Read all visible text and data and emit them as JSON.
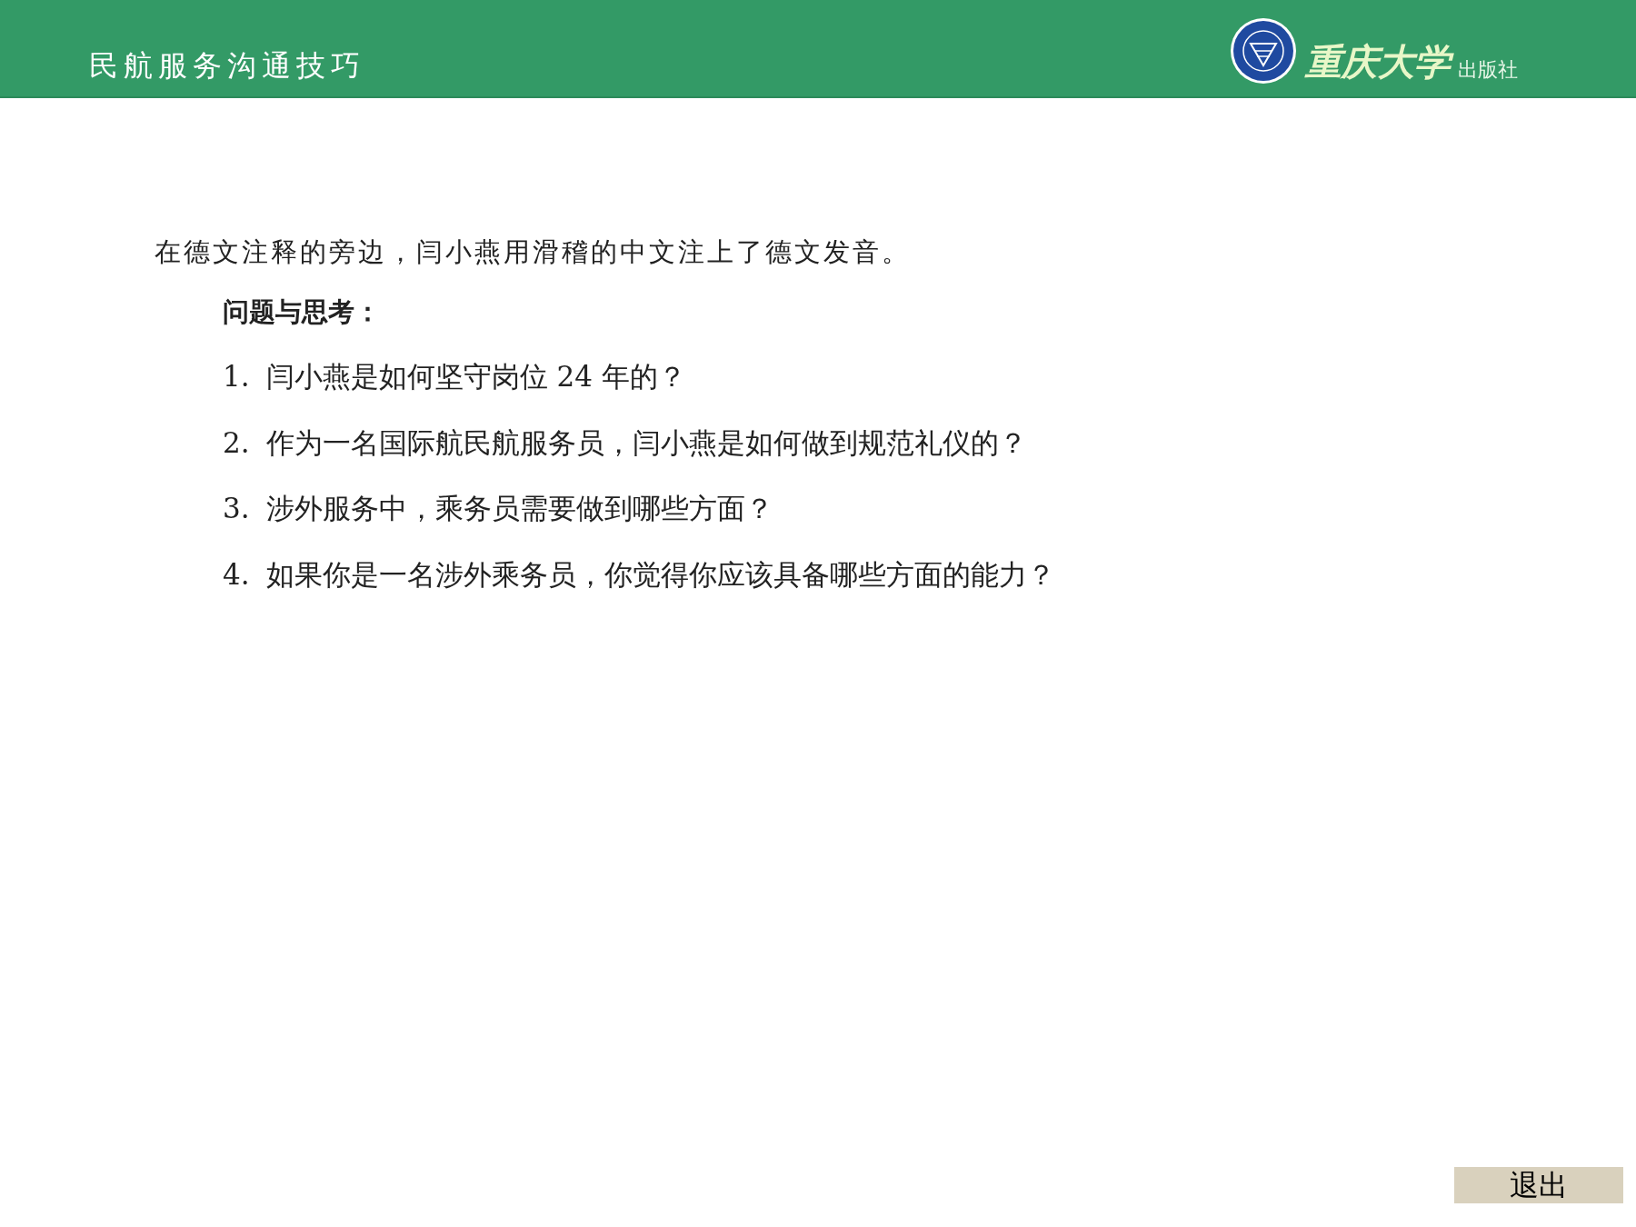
{
  "header": {
    "title": "民航服务沟通技巧",
    "logo_name": "重庆大学",
    "logo_suffix": "出版社"
  },
  "intro": "在德文注释的旁边，闫小燕用滑稽的中文注上了德文发音。",
  "questions_heading": "问题与思考：",
  "questions": [
    {
      "number": "1.",
      "text": "闫小燕是如何坚守岗位 24 年的？"
    },
    {
      "number": "2.",
      "text": "作为一名国际航民航服务员，闫小燕是如何做到规范礼仪的？"
    },
    {
      "number": "3.",
      "text": "涉外服务中，乘务员需要做到哪些方面？"
    },
    {
      "number": "4.",
      "text": "如果你是一名涉外乘务员，你觉得你应该具备哪些方面的能力？"
    }
  ],
  "exit_button": "退出"
}
